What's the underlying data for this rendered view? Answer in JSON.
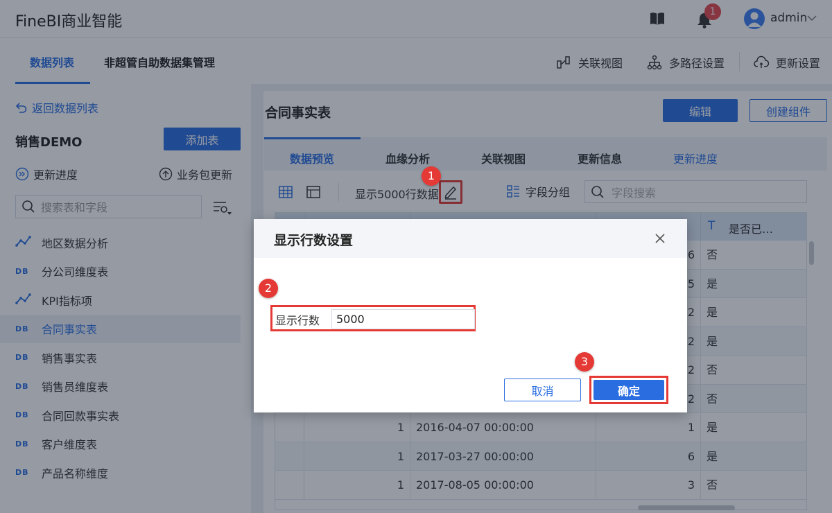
{
  "app": {
    "title": "FineBI商业智能",
    "user": "admin",
    "notification_count": "1"
  },
  "subnav": {
    "tabs": [
      "数据列表",
      "非超管自助数据集管理"
    ],
    "tools": [
      "关联视图",
      "多路径设置",
      "更新设置"
    ]
  },
  "sidebar": {
    "back_link": "返回数据列表",
    "package_name": "销售DEMO",
    "add_table": "添加表",
    "update_progress": "更新进度",
    "package_update": "业务包更新",
    "search_placeholder": "搜索表和字段",
    "tables": [
      {
        "label": "地区数据分析",
        "icon": "analysis-icon"
      },
      {
        "label": "分公司维度表",
        "icon": "DB"
      },
      {
        "label": "KPI指标项",
        "icon": "analysis-icon"
      },
      {
        "label": "合同事实表",
        "icon": "DB"
      },
      {
        "label": "销售事实表",
        "icon": "DB"
      },
      {
        "label": "销售员维度表",
        "icon": "DB"
      },
      {
        "label": "合同回款事实表",
        "icon": "DB"
      },
      {
        "label": "客户维度表",
        "icon": "DB"
      },
      {
        "label": "产品名称维度",
        "icon": "DB"
      }
    ]
  },
  "main": {
    "title": "合同事实表",
    "edit": "编辑",
    "create_component": "创建组件",
    "tabs": [
      "数据预览",
      "血缘分析",
      "关联视图",
      "更新信息",
      "更新进度"
    ],
    "row_count_text": "显示5000行数据",
    "field_group": "字段分组",
    "field_search_placeholder": "字段搜索",
    "header_type_icon": "T",
    "header_last": "是否已…",
    "rows": [
      {
        "a": "",
        "b": "",
        "c": "6",
        "d": "否"
      },
      {
        "a": "",
        "b": "",
        "c": "5",
        "d": "是"
      },
      {
        "a": "",
        "b": "",
        "c": "2",
        "d": "是"
      },
      {
        "a": "",
        "b": "",
        "c": "2",
        "d": "是"
      },
      {
        "a": "",
        "b": "",
        "c": "2",
        "d": "否"
      },
      {
        "a": "",
        "b": "",
        "c": "2",
        "d": "否"
      },
      {
        "a": "1",
        "b": "2016-04-07 00:00:00",
        "c": "1",
        "d": "是"
      },
      {
        "a": "1",
        "b": "2017-03-27 00:00:00",
        "c": "6",
        "d": "是"
      },
      {
        "a": "1",
        "b": "2017-08-05 00:00:00",
        "c": "3",
        "d": "否"
      }
    ]
  },
  "dialog": {
    "title": "显示行数设置",
    "field_label": "显示行数",
    "field_value": "5000",
    "cancel": "取消",
    "confirm": "确定"
  },
  "markers": [
    "1",
    "2",
    "3"
  ]
}
